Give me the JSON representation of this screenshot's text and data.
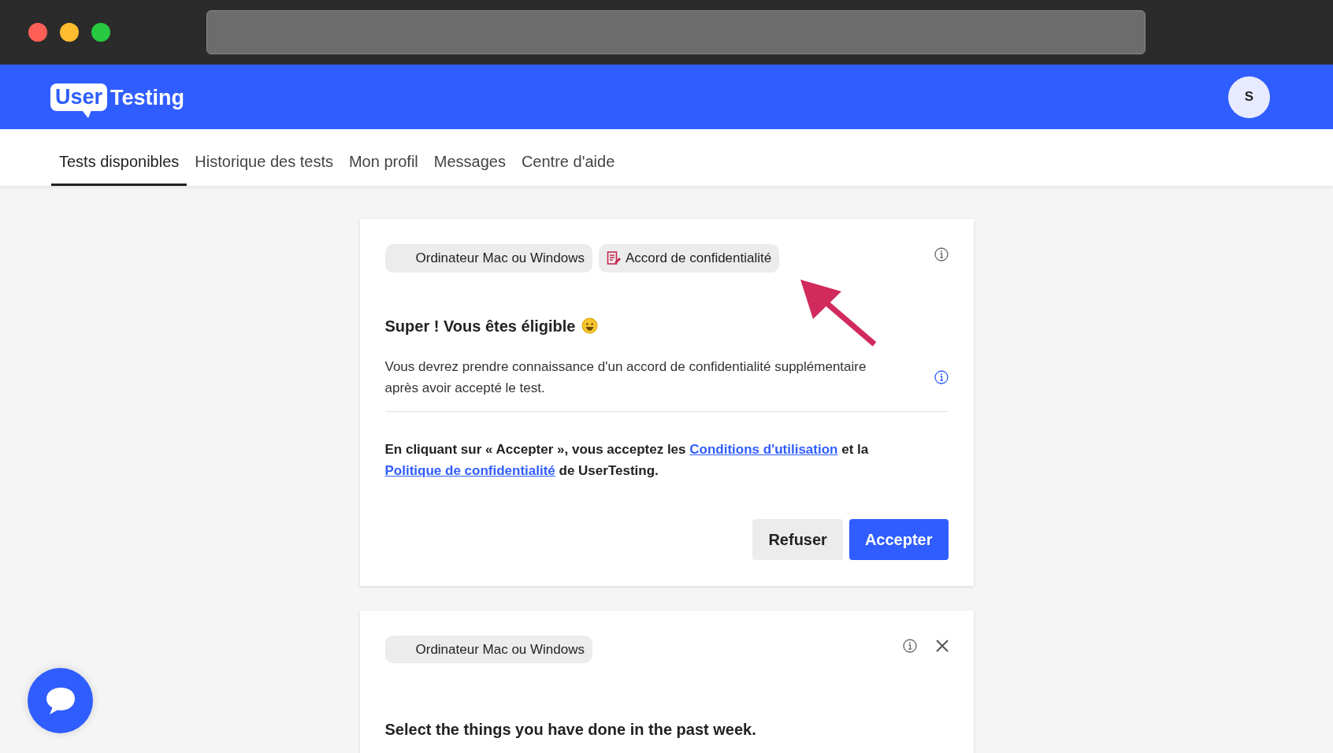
{
  "header": {
    "logo": {
      "boxed": "User",
      "rest": "Testing"
    },
    "avatar": "S"
  },
  "tabs": [
    {
      "label": "Tests disponibles",
      "selected": true
    },
    {
      "label": "Historique des tests",
      "selected": false
    },
    {
      "label": "Mon profil",
      "selected": false
    },
    {
      "label": "Messages",
      "selected": false
    },
    {
      "label": "Centre d'aide",
      "selected": false
    }
  ],
  "cards": [
    {
      "chips": [
        {
          "label": "Ordinateur Mac ou Windows",
          "kind": "device"
        },
        {
          "label": "Accord de confidentialité",
          "kind": "nda"
        }
      ],
      "closable": false,
      "title": "Super ! Vous êtes éligible",
      "emoji": true,
      "notice": "Vous devrez prendre connaissance d'un accord de confidentialité supplémentaire après avoir accepté le test.",
      "terms": [
        {
          "kind": "text",
          "text": "En cliquant sur « Accepter », vous acceptez les"
        },
        {
          "kind": "link",
          "text": "Conditions d'utilisation"
        },
        {
          "kind": "text",
          "text": "et la"
        },
        {
          "kind": "link",
          "text": "Politique de confidentialité"
        },
        {
          "kind": "text",
          "text": "de UserTesting."
        }
      ],
      "buttons": [
        {
          "label": "Refuser",
          "kind": "secondary"
        },
        {
          "label": "Accepter",
          "kind": "primary"
        }
      ]
    },
    {
      "chips": [
        {
          "label": "Ordinateur Mac ou Windows",
          "kind": "device"
        }
      ],
      "closable": true,
      "title": "Select the things you have done in the past week.",
      "emoji": false
    }
  ]
}
